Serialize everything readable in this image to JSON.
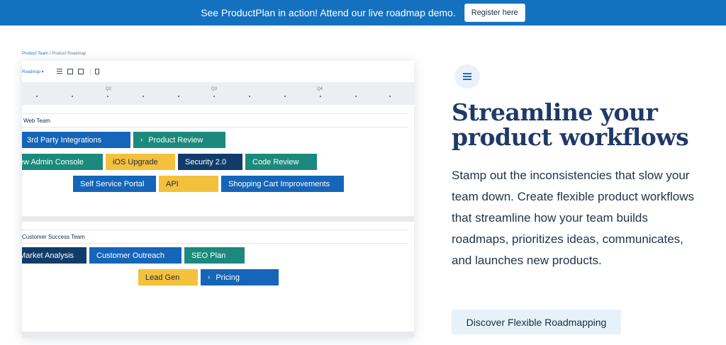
{
  "banner": {
    "text": "See ProductPlan in action! Attend our live roadmap demo.",
    "button": "Register here",
    "color": "#1471c0"
  },
  "screenshot": {
    "breadcrumb": {
      "parent": "Product Team",
      "separator": "/",
      "current": "Product Roadmap"
    },
    "toolbar": {
      "select": "Roadmap ▾",
      "icons": [
        "list-icon",
        "table-icon",
        "grid-icon",
        "trash-icon"
      ]
    },
    "quarters": [
      "Q2",
      "Q3",
      "Q4"
    ],
    "lanes": [
      {
        "title": "Web Team",
        "bars": [
          {
            "label": "3rd Party Integrations",
            "chevron": "",
            "color": "#1565b8",
            "text": "#ffffff"
          },
          {
            "label": "Product Review",
            "chevron": "›",
            "color": "#1b8a7c",
            "text": "#ffffff"
          },
          {
            "label": "New Admin Console",
            "chevron": "",
            "color": "#1b8a7c",
            "text": "#ffffff"
          },
          {
            "label": "iOS Upgrade",
            "chevron": "",
            "color": "#f4c13d",
            "text": "#1a2b44"
          },
          {
            "label": "Security 2.0",
            "chevron": "",
            "color": "#113c6a",
            "text": "#ffffff"
          },
          {
            "label": "Code Review",
            "chevron": "",
            "color": "#1b8a7c",
            "text": "#ffffff"
          },
          {
            "label": "Self Service Portal",
            "chevron": "",
            "color": "#1565b8",
            "text": "#ffffff"
          },
          {
            "label": "API",
            "chevron": "",
            "color": "#f4c13d",
            "text": "#1a2b44"
          },
          {
            "label": "Shopping Cart Improvements",
            "chevron": "",
            "color": "#1565b8",
            "text": "#ffffff"
          }
        ]
      },
      {
        "title": "Customer Success Team",
        "bars": [
          {
            "label": "Market Analysis",
            "chevron": "",
            "color": "#113c6a",
            "text": "#ffffff"
          },
          {
            "label": "Customer Outreach",
            "chevron": "",
            "color": "#1565b8",
            "text": "#ffffff"
          },
          {
            "label": "SEO Plan",
            "chevron": "",
            "color": "#1b8a7c",
            "text": "#ffffff"
          },
          {
            "label": "Lead Gen",
            "chevron": "",
            "color": "#f4c13d",
            "text": "#1a2b44"
          },
          {
            "label": "Pricing",
            "chevron": "›",
            "color": "#1565b8",
            "text": "#ffffff"
          }
        ]
      }
    ]
  },
  "feature": {
    "icon": "menu-icon",
    "headline": "Streamline your product workflows",
    "body": "Stamp out the inconsistencies that slow your team down. Create flexible product workflows that streamline how your team builds roadmaps, prioritizes ideas, communicates, and launches new products.",
    "cta": "Discover Flexible Roadmapping"
  }
}
